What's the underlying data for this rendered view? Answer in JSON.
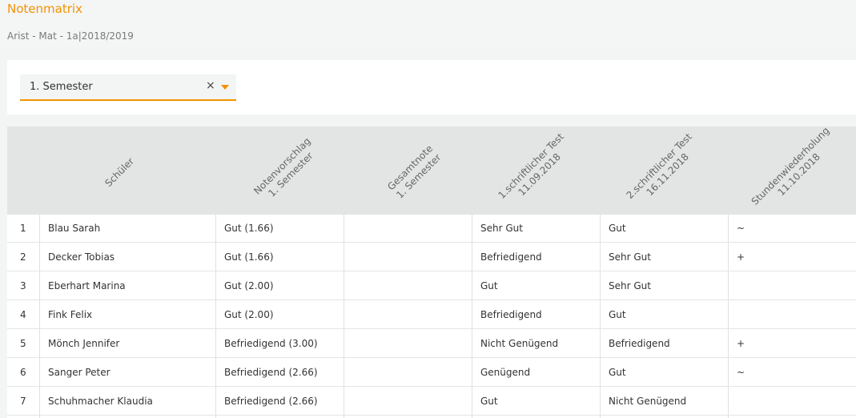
{
  "header": {
    "title": "Notenmatrix",
    "subtitle": "Arist - Mat - 1a|2018/2019"
  },
  "filter": {
    "selected": "1. Semester",
    "clear_glyph": "×"
  },
  "table": {
    "columns": [
      {
        "l1": "Schüler",
        "l2": ""
      },
      {
        "l1": "Notenvorschlag",
        "l2": "1. Semester"
      },
      {
        "l1": "Gesamtnote",
        "l2": "1. Semester"
      },
      {
        "l1": "1.schriftlicher Test",
        "l2": "11.09.2018"
      },
      {
        "l1": "2.schriftlicher Test",
        "l2": "16.11.2018"
      },
      {
        "l1": "Stundenwiederholung",
        "l2": "11.10.2018"
      }
    ],
    "rows": [
      {
        "nr": "1",
        "name": "Blau Sarah",
        "vorschlag": "Gut (1.66)",
        "gesamt": "",
        "test1": "Sehr Gut",
        "test2": "Gut",
        "wdh": "~"
      },
      {
        "nr": "2",
        "name": "Decker Tobias",
        "vorschlag": "Gut (1.66)",
        "gesamt": "",
        "test1": "Befriedigend",
        "test2": "Sehr Gut",
        "wdh": "+"
      },
      {
        "nr": "3",
        "name": "Eberhart Marina",
        "vorschlag": "Gut (2.00)",
        "gesamt": "",
        "test1": "Gut",
        "test2": "Sehr Gut",
        "wdh": ""
      },
      {
        "nr": "4",
        "name": "Fink Felix",
        "vorschlag": "Gut (2.00)",
        "gesamt": "",
        "test1": "Befriedigend",
        "test2": "Gut",
        "wdh": ""
      },
      {
        "nr": "5",
        "name": "Mönch Jennifer",
        "vorschlag": "Befriedigend (3.00)",
        "gesamt": "",
        "test1": "Nicht Genügend",
        "test2": "Befriedigend",
        "wdh": "+"
      },
      {
        "nr": "6",
        "name": "Sanger Peter",
        "vorschlag": "Befriedigend (2.66)",
        "gesamt": "",
        "test1": "Genügend",
        "test2": "Gut",
        "wdh": "~"
      },
      {
        "nr": "7",
        "name": "Schuhmacher Klaudia",
        "vorschlag": "Befriedigend (2.66)",
        "gesamt": "",
        "test1": "Gut",
        "test2": "Nicht Genügend",
        "wdh": ""
      }
    ]
  }
}
